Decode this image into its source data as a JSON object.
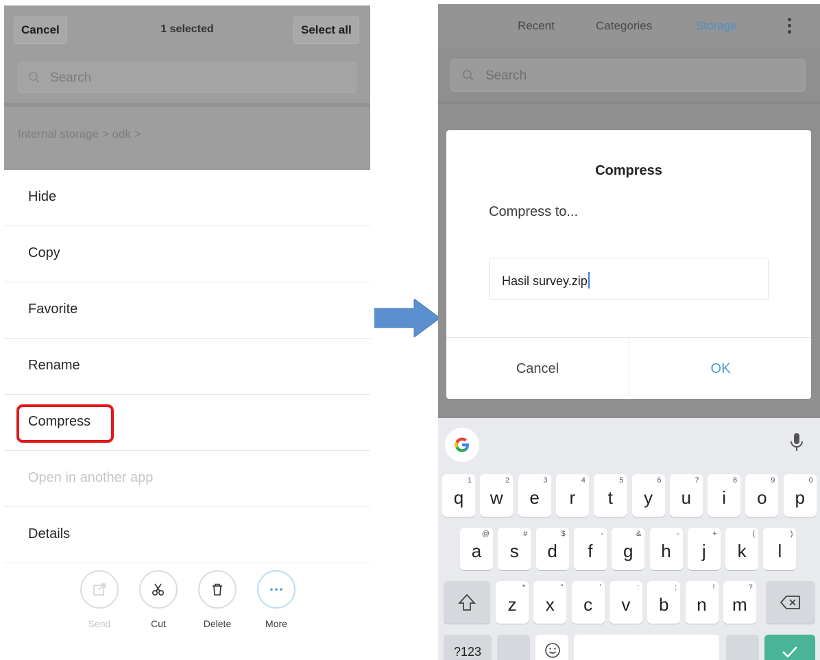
{
  "left": {
    "topbar": {
      "cancel_label": "Cancel",
      "selected_label": "1 selected",
      "select_all_label": "Select all"
    },
    "search": {
      "placeholder": "Search"
    },
    "breadcrumb": "Internal storage > odk >",
    "menu": [
      {
        "label": "Hide",
        "enabled": true
      },
      {
        "label": "Copy",
        "enabled": true
      },
      {
        "label": "Favorite",
        "enabled": true
      },
      {
        "label": "Rename",
        "enabled": true
      },
      {
        "label": "Compress",
        "enabled": true,
        "highlighted": true
      },
      {
        "label": "Open in another app",
        "enabled": false
      },
      {
        "label": "Details",
        "enabled": true
      }
    ],
    "toolbar": [
      {
        "label": "Send",
        "icon": "share-icon",
        "enabled": false
      },
      {
        "label": "Cut",
        "icon": "scissors-icon",
        "enabled": true
      },
      {
        "label": "Delete",
        "icon": "trash-icon",
        "enabled": true
      },
      {
        "label": "More",
        "icon": "ellipsis-icon",
        "enabled": true
      }
    ],
    "highlight_color": "#e01818"
  },
  "right": {
    "tabs": [
      {
        "label": "Recent",
        "active": false
      },
      {
        "label": "Categories",
        "active": false
      },
      {
        "label": "Storage",
        "active": true
      }
    ],
    "search": {
      "placeholder": "Search"
    },
    "dialog": {
      "title": "Compress",
      "subtitle": "Compress to...",
      "input_value": "Hasil survey.zip",
      "cancel_label": "Cancel",
      "ok_label": "OK"
    },
    "keyboard": {
      "row1": [
        {
          "k": "q",
          "s": "1"
        },
        {
          "k": "w",
          "s": "2"
        },
        {
          "k": "e",
          "s": "3"
        },
        {
          "k": "r",
          "s": "4"
        },
        {
          "k": "t",
          "s": "5"
        },
        {
          "k": "y",
          "s": "6"
        },
        {
          "k": "u",
          "s": "7"
        },
        {
          "k": "i",
          "s": "8"
        },
        {
          "k": "o",
          "s": "9"
        },
        {
          "k": "p",
          "s": "0"
        }
      ],
      "row2": [
        {
          "k": "a",
          "s": "@"
        },
        {
          "k": "s",
          "s": "#"
        },
        {
          "k": "d",
          "s": "$"
        },
        {
          "k": "f",
          "s": "-"
        },
        {
          "k": "g",
          "s": "&"
        },
        {
          "k": "h",
          "s": "-"
        },
        {
          "k": "j",
          "s": "+"
        },
        {
          "k": "k",
          "s": "("
        },
        {
          "k": "l",
          "s": ")"
        }
      ],
      "row3": [
        {
          "k": "z",
          "s": "*"
        },
        {
          "k": "x",
          "s": "\""
        },
        {
          "k": "c",
          "s": "'"
        },
        {
          "k": "v",
          "s": ":"
        },
        {
          "k": "b",
          "s": ";"
        },
        {
          "k": "n",
          "s": "!"
        },
        {
          "k": "m",
          "s": "?"
        }
      ],
      "symbols_label": "?123",
      "accent_color": "#4ab497"
    },
    "link_color": "#4a9ad8"
  },
  "arrow_color": "#5b8fcf"
}
